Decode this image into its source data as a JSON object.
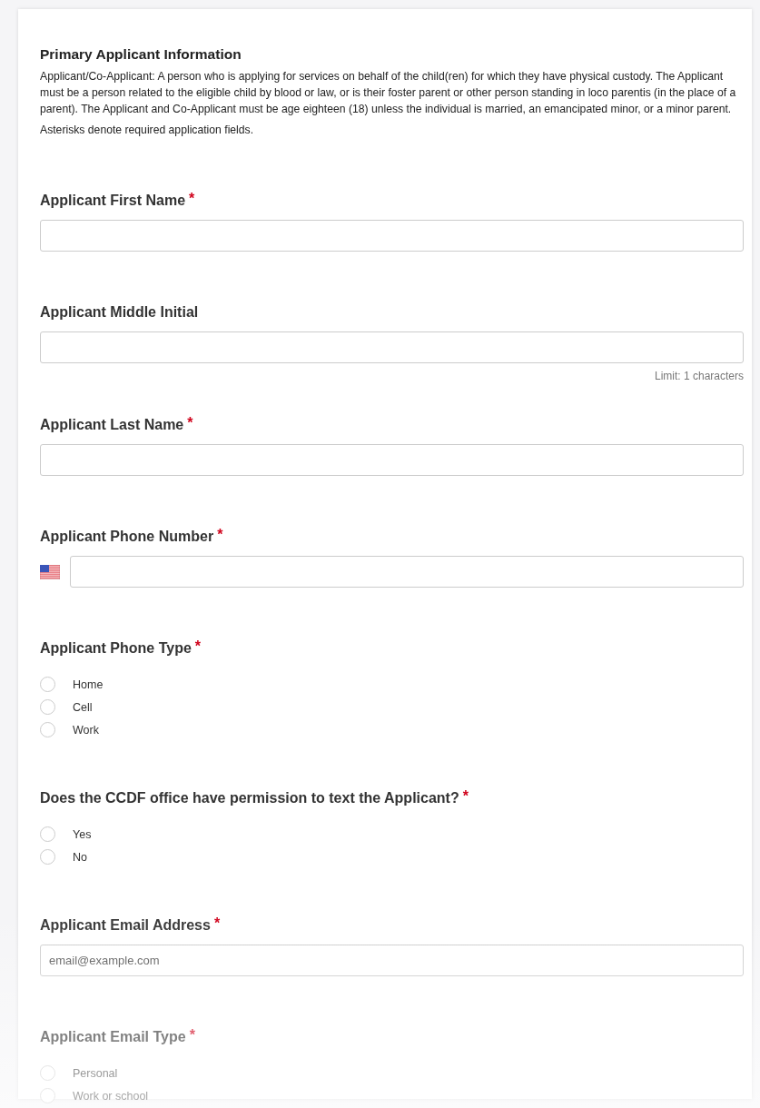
{
  "section": {
    "title": "Primary Applicant Information",
    "description": "Applicant/Co-Applicant: A person who is applying for services on behalf of the child(ren) for which they have physical custody. The Applicant must be a person related to the eligible child by blood or law, or is their foster parent or other person standing in loco parentis (in the place of a parent).  The Applicant and Co-Applicant must be age eighteen (18) unless the individual is married, an emancipated minor, or a minor parent.",
    "note": "Asterisks denote required application fields."
  },
  "fields": [
    {
      "kind": "text",
      "label": "Applicant First Name",
      "required_mark": "*"
    },
    {
      "kind": "text",
      "label": "Applicant Middle Initial",
      "hint": "Limit: 1 characters"
    },
    {
      "kind": "text",
      "label": "Applicant Last Name",
      "required_mark": "*"
    },
    {
      "kind": "phone",
      "label": "Applicant Phone Number",
      "required_mark": "*"
    },
    {
      "kind": "radio",
      "label": "Applicant Phone Type",
      "required_mark": "*",
      "options": [
        {
          "label": "Home",
          "selected": false
        },
        {
          "label": "Cell",
          "selected": false
        },
        {
          "label": "Work",
          "selected": false
        }
      ]
    },
    {
      "kind": "radio",
      "label": "Does the CCDF office have permission to text the Applicant?",
      "required_mark": "*",
      "options": [
        {
          "label": "Yes",
          "selected": false
        },
        {
          "label": "No",
          "selected": false
        }
      ]
    },
    {
      "kind": "text",
      "label": "Applicant Email Address",
      "required_mark": "*",
      "placeholder": "email@example.com"
    },
    {
      "kind": "radio",
      "label": "Applicant Email Type",
      "required_mark": "*",
      "options": [
        {
          "label": "Personal",
          "selected": false
        },
        {
          "label": "Work or school",
          "selected": false
        }
      ]
    }
  ]
}
